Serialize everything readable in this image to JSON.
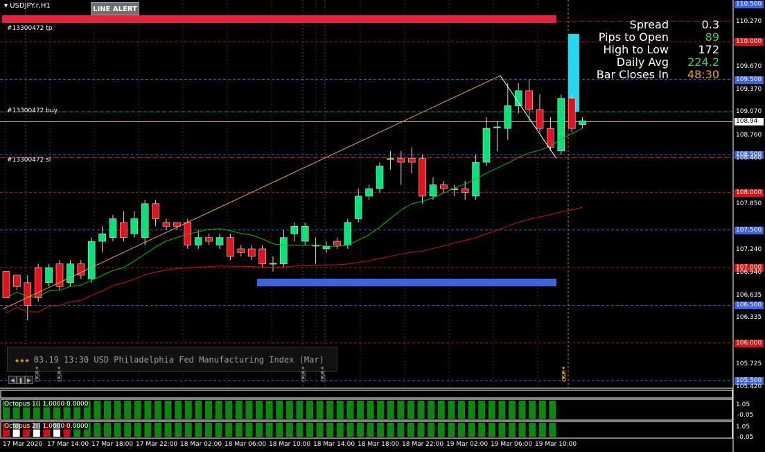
{
  "header": {
    "symbol": "USDJPY.r,H1",
    "line_alert_label": "LINE ALERT"
  },
  "orders": {
    "tp": "#13300472 tp",
    "buy": "#13300472 buy",
    "sl": "#13300472 sl"
  },
  "info_panel": [
    {
      "label": "Spread",
      "value": "0.3",
      "color": "#ffffff"
    },
    {
      "label": "Pips to Open",
      "value": "89",
      "color": "#39d353"
    },
    {
      "label": "High to Low",
      "value": "172",
      "color": "#ffffff"
    },
    {
      "label": "Daily Avg",
      "value": "224.2",
      "color": "#39d353"
    },
    {
      "label": "Bar Closes In",
      "value": "48:30",
      "color": "#f0a030"
    }
  ],
  "news": {
    "stars": "★★★",
    "text": "03.19 13:30 USD Philadelphia Fed Manufacturing Index (Mar)"
  },
  "price_axis": {
    "levels": [
      "110.500",
      "110.270",
      "110.000",
      "109.670",
      "109.500",
      "109.370",
      "109.070",
      "108.940",
      "108.760",
      "108.500",
      "108.460",
      "108.000",
      "107.850",
      "107.500",
      "107.240",
      "107.000",
      "106.940",
      "106.635",
      "106.500",
      "106.335",
      "106.000",
      "105.725",
      "105.500",
      "105.420"
    ],
    "current_price": "108.94"
  },
  "time_axis": [
    "17 Mar 2020",
    "17 Mar 14:00",
    "17 Mar 18:00",
    "17 Mar 22:00",
    "18 Mar 02:00",
    "18 Mar 06:00",
    "18 Mar 10:00",
    "18 Mar 14:00",
    "18 Mar 18:00",
    "18 Mar 22:00",
    "19 Mar 02:00",
    "19 Mar 06:00",
    "19 Mar 10:00"
  ],
  "event_markers": {
    "usd": "USD",
    "stars": "★★★"
  },
  "indicators": [
    {
      "label": "Octopus 1() 1.0000 0.0000",
      "axis_top": "1.05",
      "axis_bottom": "-0.05"
    },
    {
      "label": "Octopus 2() 1.0000 0.0000",
      "axis_top": "1.05",
      "axis_bottom": "-0.05"
    }
  ],
  "colors": {
    "bull": "#00e676",
    "bear": "#e8101a",
    "ma_fast": "#00c000",
    "ma_slow": "#d01010",
    "trend": "#f0a040",
    "blue_zone": "#3a64e0",
    "cyan_bar": "#29d6f0",
    "tp_bar": "#e8203a"
  },
  "chart_data": {
    "type": "candlestick",
    "candles": [
      [
        106.95,
        106.6,
        106.6,
        106.8
      ],
      [
        106.9,
        106.75,
        106.7,
        106.85
      ],
      [
        106.8,
        106.5,
        106.3,
        106.9
      ],
      [
        107.0,
        106.6,
        106.55,
        107.05
      ],
      [
        106.8,
        107.0,
        106.75,
        107.05
      ],
      [
        107.05,
        106.75,
        106.7,
        107.1
      ],
      [
        106.8,
        107.05,
        106.75,
        107.1
      ],
      [
        107.05,
        106.9,
        106.85,
        107.1
      ],
      [
        106.85,
        107.35,
        106.8,
        107.4
      ],
      [
        107.35,
        107.45,
        107.2,
        107.55
      ],
      [
        107.4,
        107.65,
        107.35,
        107.7
      ],
      [
        107.6,
        107.4,
        107.35,
        107.75
      ],
      [
        107.45,
        107.65,
        107.4,
        107.75
      ],
      [
        107.4,
        107.85,
        107.3,
        107.9
      ],
      [
        107.85,
        107.65,
        107.55,
        107.9
      ],
      [
        107.6,
        107.55,
        107.5,
        107.65
      ],
      [
        107.6,
        107.55,
        107.5,
        107.6
      ],
      [
        107.6,
        107.3,
        107.25,
        107.65
      ],
      [
        107.3,
        107.4,
        107.25,
        107.5
      ],
      [
        107.4,
        107.35,
        107.3,
        107.45
      ],
      [
        107.3,
        107.4,
        107.25,
        107.45
      ],
      [
        107.4,
        107.15,
        107.1,
        107.45
      ],
      [
        107.25,
        107.2,
        107.15,
        107.3
      ],
      [
        107.25,
        107.15,
        107.1,
        107.3
      ],
      [
        107.25,
        107.05,
        107.0,
        107.3
      ],
      [
        107.05,
        107.06,
        106.95,
        107.15
      ],
      [
        107.05,
        107.4,
        107.0,
        107.5
      ],
      [
        107.45,
        107.55,
        107.35,
        107.6
      ],
      [
        107.35,
        107.55,
        107.3,
        107.6
      ],
      [
        107.3,
        107.3,
        107.05,
        107.4
      ],
      [
        107.25,
        107.28,
        107.2,
        107.35
      ],
      [
        107.35,
        107.3,
        107.25,
        107.4
      ],
      [
        107.3,
        107.6,
        107.25,
        107.65
      ],
      [
        107.65,
        107.95,
        107.6,
        108.05
      ],
      [
        107.95,
        108.05,
        107.9,
        108.1
      ],
      [
        108.05,
        108.35,
        108.0,
        108.4
      ],
      [
        108.45,
        108.45,
        108.3,
        108.55
      ],
      [
        108.45,
        108.4,
        108.1,
        108.55
      ],
      [
        108.45,
        108.4,
        108.25,
        108.6
      ],
      [
        108.45,
        107.95,
        107.85,
        108.5
      ],
      [
        107.95,
        108.1,
        107.9,
        108.2
      ],
      [
        108.1,
        108.05,
        108.0,
        108.15
      ],
      [
        108.05,
        108.05,
        107.95,
        108.1
      ],
      [
        108.05,
        108.0,
        107.9,
        108.15
      ],
      [
        107.95,
        108.4,
        107.9,
        108.5
      ],
      [
        108.4,
        108.85,
        108.35,
        109.0
      ],
      [
        108.86,
        108.87,
        108.55,
        108.95
      ],
      [
        108.85,
        109.15,
        108.7,
        109.45
      ],
      [
        109.15,
        109.35,
        109.05,
        109.45
      ],
      [
        109.35,
        109.1,
        108.95,
        109.5
      ],
      [
        109.1,
        108.85,
        108.8,
        109.3
      ],
      [
        108.85,
        108.6,
        108.55,
        109.0
      ],
      [
        108.55,
        109.25,
        108.5,
        109.3
      ],
      [
        109.25,
        108.85,
        108.8,
        109.3
      ],
      [
        108.9,
        108.95,
        108.85,
        109.0
      ]
    ]
  }
}
